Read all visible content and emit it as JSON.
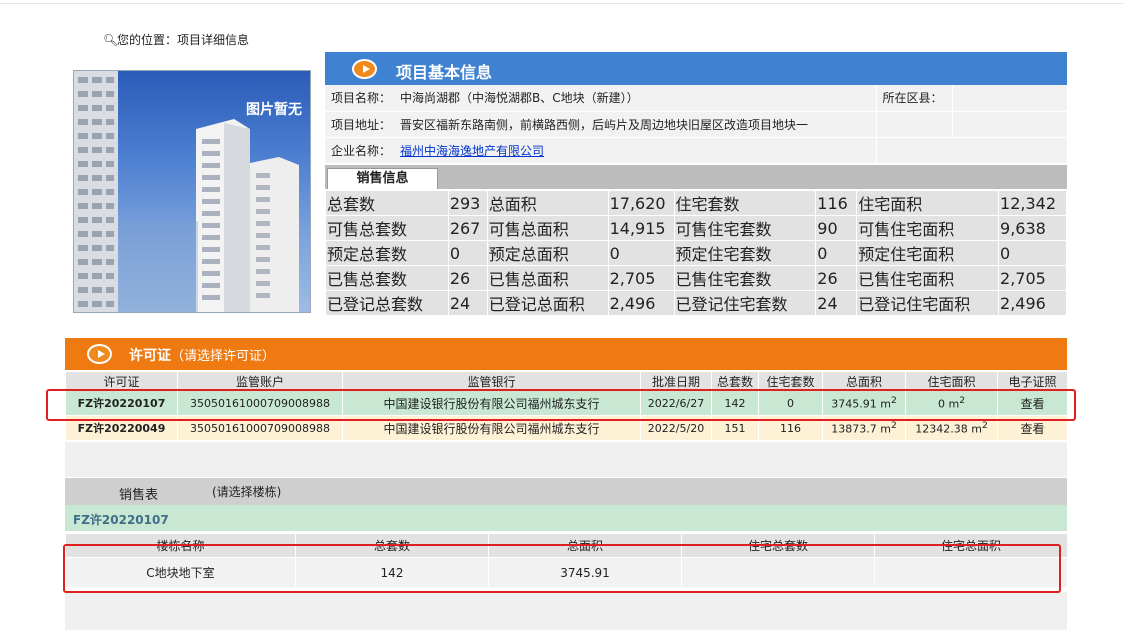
{
  "breadcrumb": {
    "label": "您的位置：",
    "current": "项目详细信息",
    "icon": "pin-icon"
  },
  "photo": {
    "placeholder_text": "图片暂无"
  },
  "basic_info": {
    "header_title": "项目基本信息",
    "rows": [
      {
        "label": "项目名称：",
        "value": "中海尚湖郡（中海悦湖郡B、C地块（新建））",
        "extra_label": "所在区县：",
        "extra_value": ""
      },
      {
        "label": "项目地址：",
        "value": "晋安区福新东路南侧，前横路西侧，后屿片及周边地块旧屋区改造项目地块一",
        "extra_label": "",
        "extra_value": ""
      },
      {
        "label": "企业名称：",
        "value": "福州中海海逸地产有限公司",
        "extra_label": "",
        "extra_value": ""
      }
    ]
  },
  "sales_info": {
    "tab_label": "销售信息",
    "rows": [
      [
        "总套数",
        "293",
        "总面积",
        "17,620",
        "住宅套数",
        "116",
        "住宅面积",
        "12,342"
      ],
      [
        "可售总套数",
        "267",
        "可售总面积",
        "14,915",
        "可售住宅套数",
        "90",
        "可售住宅面积",
        "9,638"
      ],
      [
        "预定总套数",
        "0",
        "预定总面积",
        "0",
        "预定住宅套数",
        "0",
        "预定住宅面积",
        "0"
      ],
      [
        "已售总套数",
        "26",
        "已售总面积",
        "2,705",
        "已售住宅套数",
        "26",
        "已售住宅面积",
        "2,705"
      ],
      [
        "已登记总套数",
        "24",
        "已登记总面积",
        "2,496",
        "已登记住宅套数",
        "24",
        "已登记住宅面积",
        "2,496"
      ]
    ]
  },
  "permits": {
    "header_title": "许可证",
    "header_hint": "（请选择许可证）",
    "columns": [
      "许可证",
      "监管账户",
      "监管银行",
      "批准日期",
      "总套数",
      "住宅套数",
      "总面积",
      "住宅面积",
      "电子证照"
    ],
    "rows": [
      {
        "permit": "FZ许20220107",
        "account": "35050161000709008988",
        "bank": "中国建设银行股份有限公司福州城东支行",
        "date": "2022/6/27",
        "total": "142",
        "residential": "0",
        "area": "3745.91 m",
        "res_area": "0 m",
        "unit_sup": "2",
        "action": "查看"
      },
      {
        "permit": "FZ许20220049",
        "account": "35050161000709008988",
        "bank": "中国建设银行股份有限公司福州城东支行",
        "date": "2022/5/20",
        "total": "151",
        "residential": "116",
        "area": "13873.7 m",
        "res_area": "12342.38 m",
        "unit_sup": "2",
        "action": "查看"
      }
    ]
  },
  "sales_table": {
    "label": "销售表",
    "hint": "(请选择楼栋)",
    "selected_permit": "FZ许20220107",
    "columns": [
      "楼栋名称",
      "总套数",
      "总面积",
      "住宅总套数",
      "住宅总面积"
    ],
    "rows": [
      {
        "name": "C地块地下室",
        "total": "142",
        "area": "3745.91",
        "res_total": "",
        "res_area": ""
      }
    ]
  },
  "annotation_color": "#e02020"
}
